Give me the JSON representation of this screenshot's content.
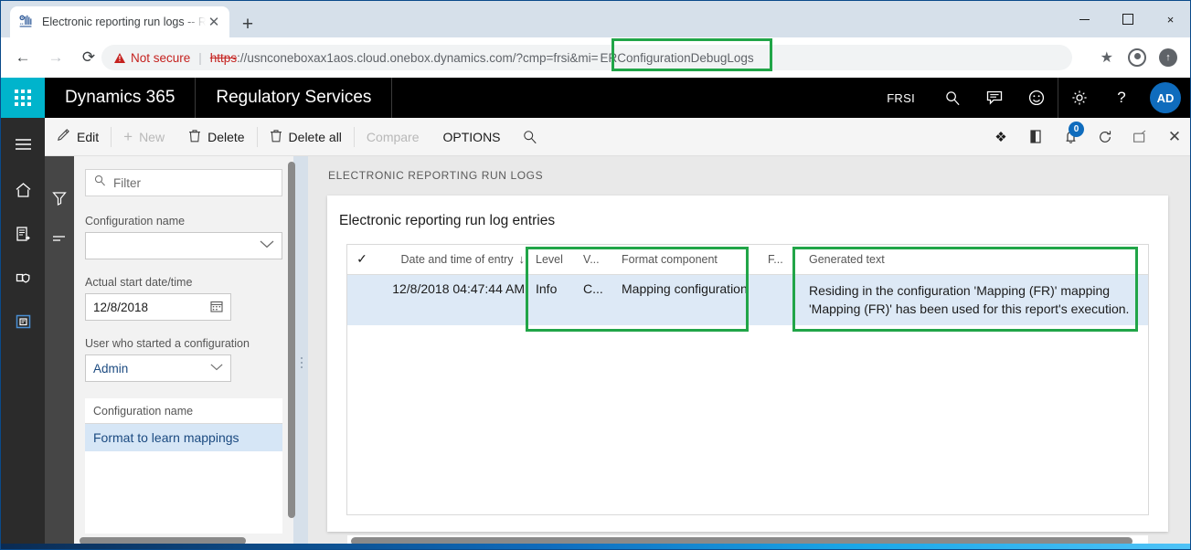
{
  "browser": {
    "tab": {
      "title": "Electronic reporting run logs -- R",
      "favicon_icon": "dynamics-favicon-icon",
      "close_icon": "close-icon"
    },
    "new_tab_label": "+",
    "window_controls": {
      "minimize": "minimize-icon",
      "maximize": "maximize-icon",
      "close": "×"
    },
    "nav": {
      "back": "←",
      "forward": "→",
      "reload": "⟳"
    },
    "omnibox": {
      "security_label": "Not secure",
      "separator": "|",
      "url_scheme": "https",
      "url_rest": "://usnconeboxax1aos.cloud.onebox.dynamics.com/?cmp=frsi&mi=",
      "url_highlighted": "ERConfigurationDebugLogs",
      "star_icon": "★",
      "avatar_icon": "profile-icon",
      "update_icon": "↑"
    }
  },
  "d365_header": {
    "waffle_icon": "app-launcher-icon",
    "brand": "Dynamics 365",
    "module": "Regulatory Services",
    "company": "FRSI",
    "icons": [
      {
        "name": "search-icon",
        "glyph": "⚲"
      },
      {
        "name": "feedback-icon",
        "glyph": "▤"
      },
      {
        "name": "smiley-icon",
        "glyph": "☺"
      },
      {
        "name": "settings-gear-icon",
        "glyph": "⚙"
      },
      {
        "name": "help-icon",
        "glyph": "?"
      }
    ],
    "avatar_initials": "AD"
  },
  "nav_rail": {
    "items": [
      {
        "name": "hamburger-menu-icon",
        "glyph": "☰"
      },
      {
        "name": "home-icon",
        "glyph": "⌂"
      },
      {
        "name": "recent-icon",
        "glyph": "▤"
      },
      {
        "name": "favorites-icon",
        "glyph": "⬔"
      },
      {
        "name": "workspaces-icon",
        "glyph": "▣"
      }
    ]
  },
  "command_bar": {
    "buttons": [
      {
        "label": "Edit",
        "icon": "pencil-icon",
        "glyph": "✎",
        "disabled": false
      },
      {
        "label": "New",
        "icon": "plus-icon",
        "glyph": "+",
        "disabled": true
      },
      {
        "label": "Delete",
        "icon": "trash-icon",
        "glyph": "🗑",
        "disabled": false
      },
      {
        "label": "Delete all",
        "icon": "trash-icon",
        "glyph": "🗑",
        "disabled": false
      },
      {
        "label": "Compare",
        "icon": "compare-icon",
        "glyph": "",
        "disabled": true
      },
      {
        "label": "OPTIONS",
        "icon": "options-icon",
        "glyph": "",
        "disabled": false
      }
    ],
    "search_icon": "⚲",
    "right_icons": [
      {
        "name": "attach-icon",
        "glyph": "❖",
        "badge": ""
      },
      {
        "name": "office-app-icon",
        "glyph": "◧",
        "badge": ""
      },
      {
        "name": "notifications-icon",
        "glyph": "🕭",
        "badge": "0"
      },
      {
        "name": "refresh-icon",
        "glyph": "↻",
        "badge": ""
      },
      {
        "name": "popout-icon",
        "glyph": "⬈",
        "badge": ""
      },
      {
        "name": "close-icon",
        "glyph": "✕",
        "badge": ""
      }
    ]
  },
  "filter_pane": {
    "rail_icons": [
      {
        "name": "filter-funnel-icon",
        "glyph": "▽"
      },
      {
        "name": "sort-lines-icon",
        "glyph": "≡"
      }
    ],
    "search_placeholder": "Filter",
    "search_icon": "⚲",
    "fields": [
      {
        "label": "Configuration name",
        "value": "",
        "control": "dropdown"
      },
      {
        "label": "Actual start date/time",
        "value": "12/8/2018",
        "control": "date"
      },
      {
        "label": "User who started a configuration",
        "value": "Admin",
        "control": "dropdown"
      }
    ],
    "list": {
      "header": "Configuration name",
      "items": [
        "Format to learn mappings"
      ],
      "selected_index": 0
    }
  },
  "main": {
    "page_caption": "ELECTRONIC REPORTING RUN LOGS",
    "card_title": "Electronic reporting run log entries",
    "grid": {
      "columns": [
        {
          "key": "select",
          "header": "✓"
        },
        {
          "key": "datetime",
          "header": "Date and time of entry",
          "sorted": "desc",
          "sort_glyph": "↓"
        },
        {
          "key": "level",
          "header": "Level"
        },
        {
          "key": "v",
          "header": "V..."
        },
        {
          "key": "component",
          "header": "Format component"
        },
        {
          "key": "f",
          "header": "F..."
        },
        {
          "key": "generated",
          "header": "Generated text"
        }
      ],
      "rows": [
        {
          "select": "",
          "datetime": "12/8/2018 04:47:44 AM",
          "level": "Info",
          "v": "C...",
          "component": "Mapping configuration",
          "f": "",
          "generated": "Residing in the configuration 'Mapping (FR)' mapping 'Mapping (FR)' has been used for this report's execution.",
          "selected": true
        }
      ]
    }
  },
  "annotations": {
    "highlight_color": "#21a548",
    "boxes": [
      {
        "name": "url-parameter-highlight",
        "target": "ERConfigurationDebugLogs"
      },
      {
        "name": "grid-columns-highlight",
        "target": "Level / V... / Format component"
      },
      {
        "name": "generated-text-highlight",
        "target": "Generated text"
      }
    ]
  }
}
